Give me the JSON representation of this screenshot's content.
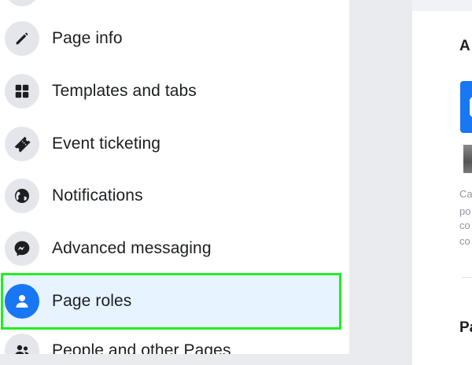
{
  "sidebar": {
    "items": [
      {
        "id": "page-info",
        "label": "Page info",
        "icon": "pencil-icon"
      },
      {
        "id": "templates-and-tabs",
        "label": "Templates and tabs",
        "icon": "grid-icon"
      },
      {
        "id": "event-ticketing",
        "label": "Event ticketing",
        "icon": "ticket-icon"
      },
      {
        "id": "notifications",
        "label": "Notifications",
        "icon": "globe-icon"
      },
      {
        "id": "advanced-messaging",
        "label": "Advanced messaging",
        "icon": "messenger-icon"
      },
      {
        "id": "page-roles",
        "label": "Page roles",
        "icon": "person-icon",
        "selected": true
      },
      {
        "id": "people-and-other-pages",
        "label": "People and other Pages",
        "icon": "people-icon"
      }
    ]
  },
  "main": {
    "heading_top": "A",
    "heading_bottom": "Pa",
    "text_lines": [
      "Ca",
      "po",
      "co",
      "co"
    ]
  },
  "colors": {
    "selected_bg": "#e7f3ff",
    "highlight_outline": "#22ee22",
    "accent_blue": "#1877f2",
    "icon_bg": "#e4e6eb"
  }
}
